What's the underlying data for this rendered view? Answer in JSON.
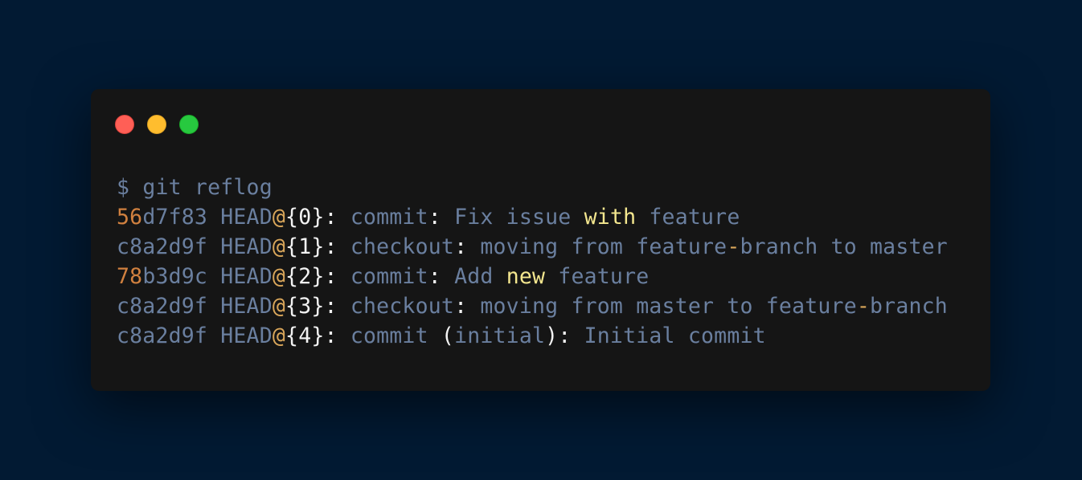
{
  "window": {
    "controls": [
      {
        "name": "close",
        "color": "#ff5f56"
      },
      {
        "name": "minimize",
        "color": "#ffbd2e"
      },
      {
        "name": "maximize",
        "color": "#27c93f"
      }
    ]
  },
  "terminal": {
    "prompt": "$",
    "command": "git reflog",
    "entries": [
      {
        "hash_prefix": "56",
        "hash_rest": "d7f83",
        "ref": "HEAD",
        "index": "0",
        "action": "commit",
        "message_parts": [
          "Fix issue ",
          "with",
          " feature"
        ]
      },
      {
        "hash_prefix": "",
        "hash_rest": "c8a2d9f",
        "ref": "HEAD",
        "index": "1",
        "action": "checkout",
        "message_parts": [
          "moving from feature",
          "-",
          "branch to master"
        ]
      },
      {
        "hash_prefix": "78",
        "hash_rest": "b3d9c",
        "ref": "HEAD",
        "index": "2",
        "action": "commit",
        "message_parts": [
          "Add ",
          "new",
          " feature"
        ]
      },
      {
        "hash_prefix": "",
        "hash_rest": "c8a2d9f",
        "ref": "HEAD",
        "index": "3",
        "action": "checkout",
        "message_parts": [
          "moving from master to feature",
          "-",
          "branch"
        ]
      },
      {
        "hash_prefix": "",
        "hash_rest": "c8a2d9f",
        "ref": "HEAD",
        "index": "4",
        "action": "commit",
        "action_qualifier": "initial",
        "message_parts": [
          "Initial commit"
        ]
      }
    ]
  },
  "colors": {
    "background": "#021a33",
    "window": "#151515",
    "text_muted": "#6a7f9f",
    "number_orange": "#d0803f",
    "at_gold": "#d9a65a",
    "bright_white": "#f2f2f2",
    "keyword_yellow": "#f4e78f"
  }
}
